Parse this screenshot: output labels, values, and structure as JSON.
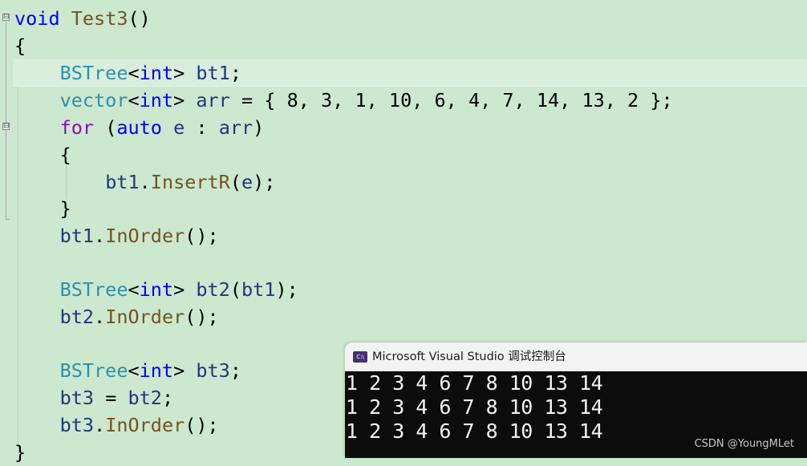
{
  "editor": {
    "lines": [
      {
        "tokens": [
          {
            "t": "void",
            "c": "kw"
          },
          {
            "t": " ",
            "c": "pl"
          },
          {
            "t": "Test3",
            "c": "fn"
          },
          {
            "t": "()",
            "c": "pl"
          }
        ]
      },
      {
        "tokens": [
          {
            "t": "{",
            "c": "pl"
          }
        ]
      },
      {
        "tokens": [
          {
            "t": "    ",
            "c": "pl"
          },
          {
            "t": "BSTree",
            "c": "ty"
          },
          {
            "t": "<",
            "c": "pl"
          },
          {
            "t": "int",
            "c": "kw"
          },
          {
            "t": "> ",
            "c": "pl"
          },
          {
            "t": "bt1",
            "c": "var"
          },
          {
            "t": ";",
            "c": "pl"
          }
        ]
      },
      {
        "tokens": [
          {
            "t": "    ",
            "c": "pl"
          },
          {
            "t": "vector",
            "c": "ty"
          },
          {
            "t": "<",
            "c": "pl"
          },
          {
            "t": "int",
            "c": "kw"
          },
          {
            "t": "> ",
            "c": "pl"
          },
          {
            "t": "arr",
            "c": "var"
          },
          {
            "t": " = { 8, 3, 1, 10, 6, 4, 7, 14, 13, 2 };",
            "c": "pl"
          }
        ]
      },
      {
        "tokens": [
          {
            "t": "    ",
            "c": "pl"
          },
          {
            "t": "for",
            "c": "kw2"
          },
          {
            "t": " (",
            "c": "pl"
          },
          {
            "t": "auto",
            "c": "kw"
          },
          {
            "t": " ",
            "c": "pl"
          },
          {
            "t": "e",
            "c": "var"
          },
          {
            "t": " : ",
            "c": "pl"
          },
          {
            "t": "arr",
            "c": "var"
          },
          {
            "t": ")",
            "c": "pl"
          }
        ]
      },
      {
        "tokens": [
          {
            "t": "    {",
            "c": "pl"
          }
        ]
      },
      {
        "tokens": [
          {
            "t": "        ",
            "c": "pl"
          },
          {
            "t": "bt1",
            "c": "var"
          },
          {
            "t": ".",
            "c": "pl"
          },
          {
            "t": "InsertR",
            "c": "fn"
          },
          {
            "t": "(",
            "c": "pl"
          },
          {
            "t": "e",
            "c": "var"
          },
          {
            "t": ");",
            "c": "pl"
          }
        ]
      },
      {
        "tokens": [
          {
            "t": "    }",
            "c": "pl"
          }
        ]
      },
      {
        "tokens": [
          {
            "t": "    ",
            "c": "pl"
          },
          {
            "t": "bt1",
            "c": "var"
          },
          {
            "t": ".",
            "c": "pl"
          },
          {
            "t": "InOrder",
            "c": "fn"
          },
          {
            "t": "();",
            "c": "pl"
          }
        ]
      },
      {
        "tokens": []
      },
      {
        "tokens": [
          {
            "t": "    ",
            "c": "pl"
          },
          {
            "t": "BSTree",
            "c": "ty"
          },
          {
            "t": "<",
            "c": "pl"
          },
          {
            "t": "int",
            "c": "kw"
          },
          {
            "t": "> ",
            "c": "pl"
          },
          {
            "t": "bt2",
            "c": "var"
          },
          {
            "t": "(",
            "c": "pl"
          },
          {
            "t": "bt1",
            "c": "var"
          },
          {
            "t": ");",
            "c": "pl"
          }
        ]
      },
      {
        "tokens": [
          {
            "t": "    ",
            "c": "pl"
          },
          {
            "t": "bt2",
            "c": "var"
          },
          {
            "t": ".",
            "c": "pl"
          },
          {
            "t": "InOrder",
            "c": "fn"
          },
          {
            "t": "();",
            "c": "pl"
          }
        ]
      },
      {
        "tokens": []
      },
      {
        "tokens": [
          {
            "t": "    ",
            "c": "pl"
          },
          {
            "t": "BSTree",
            "c": "ty"
          },
          {
            "t": "<",
            "c": "pl"
          },
          {
            "t": "int",
            "c": "kw"
          },
          {
            "t": "> ",
            "c": "pl"
          },
          {
            "t": "bt3",
            "c": "var"
          },
          {
            "t": ";",
            "c": "pl"
          }
        ]
      },
      {
        "tokens": [
          {
            "t": "    ",
            "c": "pl"
          },
          {
            "t": "bt3",
            "c": "var"
          },
          {
            "t": " = ",
            "c": "pl"
          },
          {
            "t": "bt2",
            "c": "var"
          },
          {
            "t": ";",
            "c": "pl"
          }
        ]
      },
      {
        "tokens": [
          {
            "t": "    ",
            "c": "pl"
          },
          {
            "t": "bt3",
            "c": "var"
          },
          {
            "t": ".",
            "c": "pl"
          },
          {
            "t": "InOrder",
            "c": "fn"
          },
          {
            "t": "();",
            "c": "pl"
          }
        ]
      },
      {
        "tokens": [
          {
            "t": "}",
            "c": "pl"
          }
        ]
      }
    ],
    "fold_markers": [
      "⊟",
      "⊟"
    ]
  },
  "console": {
    "icon_label": "C:\\",
    "title": "Microsoft Visual Studio 调试控制台",
    "output_lines": [
      "1 2 3 4 6 7 8 10 13 14",
      "1 2 3 4 6 7 8 10 13 14",
      "1 2 3 4 6 7 8 10 13 14"
    ]
  },
  "watermark": "CSDN @YoungMLet",
  "colors": {
    "editor_background": "#cce8cf",
    "keyword": "#0000ff",
    "control_keyword": "#8f08c4",
    "type": "#2b91af",
    "function": "#74531f",
    "variable": "#1f377f",
    "console_background": "#0c0c0c"
  }
}
